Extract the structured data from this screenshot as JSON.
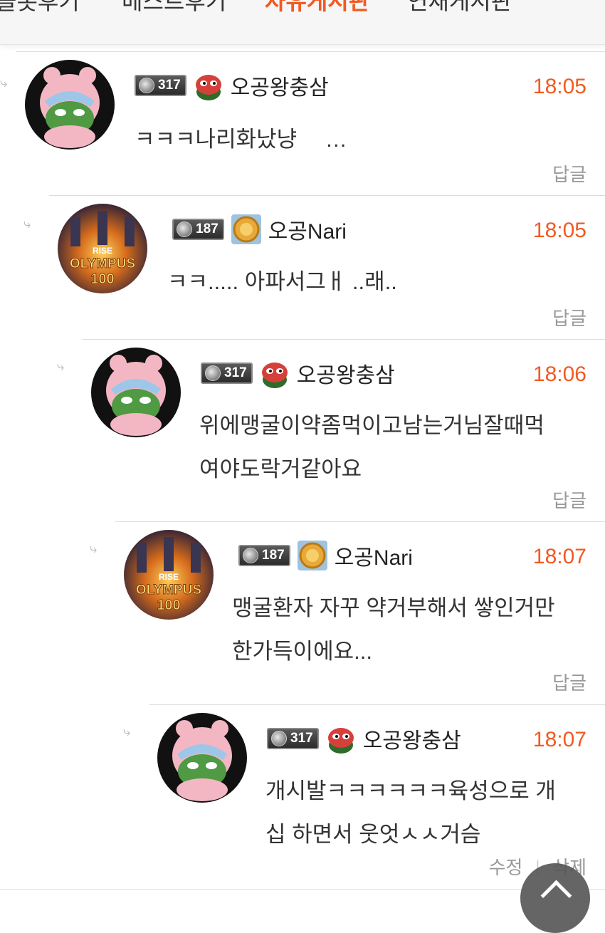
{
  "tabs": [
    {
      "label": "슬롯후기"
    },
    {
      "label": "베스트후기"
    },
    {
      "label": "자유게시판"
    },
    {
      "label": "연재게시판"
    }
  ],
  "colors": {
    "accent": "#f15a22",
    "muted": "#999999"
  },
  "comments": [
    {
      "level": "317",
      "nickname": "오공왕충삼",
      "time": "18:05",
      "lines": [
        "ㅋㅋㅋ나리화났냥　 …"
      ],
      "reply_label": "답글",
      "avatar": "pink-hood-frog-avatar",
      "grade_icon": "pepe-frog-icon"
    },
    {
      "level": "187",
      "nickname": "오공Nari",
      "time": "18:05",
      "lines": [
        "ㅋㅋ..... 아파서그ㅐ ..래.."
      ],
      "reply_label": "답글",
      "avatar": "rise-of-olympus-avatar",
      "avatar_text": [
        "RISE",
        "OLYMPUS",
        "100"
      ],
      "grade_icon": "gold-medal-icon"
    },
    {
      "level": "317",
      "nickname": "오공왕충삼",
      "time": "18:06",
      "lines": [
        "위에맹굴이약좀먹이고남는거님잘때먹",
        "여야도락거같아요"
      ],
      "reply_label": "답글",
      "avatar": "pink-hood-frog-avatar",
      "grade_icon": "pepe-frog-icon"
    },
    {
      "level": "187",
      "nickname": "오공Nari",
      "time": "18:07",
      "lines": [
        "맹굴환자 자꾸 약거부해서 쌓인거만",
        "한가득이에요..."
      ],
      "reply_label": "답글",
      "avatar": "rise-of-olympus-avatar",
      "avatar_text": [
        "RISE",
        "OLYMPUS",
        "100"
      ],
      "grade_icon": "gold-medal-icon"
    },
    {
      "level": "317",
      "nickname": "오공왕충삼",
      "time": "18:07",
      "lines": [
        "개시발ㅋㅋㅋㅋㅋㅋ육성으로 개",
        "십 하면서 웃엇ㅅㅅ거슴"
      ],
      "edit_label": "수정",
      "delete_label": "삭제",
      "avatar": "pink-hood-frog-avatar",
      "grade_icon": "pepe-frog-icon"
    }
  ],
  "scroll_top_icon": "chevron-up-icon"
}
